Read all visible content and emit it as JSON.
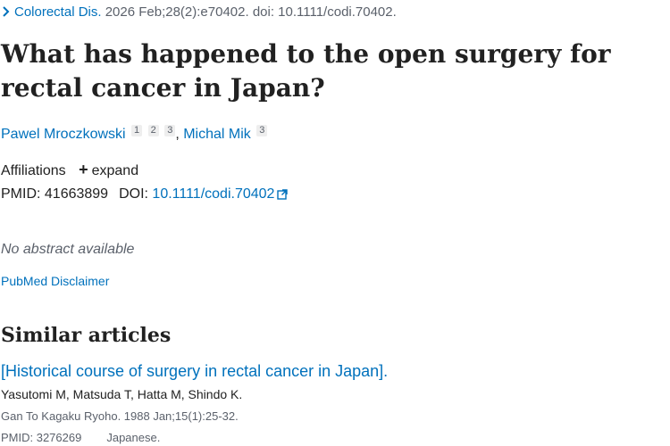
{
  "citation": {
    "journal": "Colorectal Dis.",
    "details": " 2026 Feb;28(2):e70402. doi: 10.1111/codi.70402."
  },
  "article": {
    "title": "What has happened to the open surgery for rectal cancer in Japan?",
    "authors": [
      {
        "name": "Pawel Mroczkowski",
        "affils": [
          "1",
          "2",
          "3"
        ]
      },
      {
        "name": "Michal Mik",
        "affils": [
          "3"
        ]
      }
    ],
    "author_separator": ", ",
    "affiliations_label": "Affiliations",
    "expand_label": "expand",
    "pmid_label": "PMID: ",
    "pmid": "41663899",
    "doi_label": "DOI: ",
    "doi": "10.1111/codi.70402",
    "no_abstract": "No abstract available",
    "disclaimer": "PubMed Disclaimer"
  },
  "similar": {
    "heading": "Similar articles",
    "items": [
      {
        "title": "[Historical course of surgery in rectal cancer in Japan].",
        "authors": "Yasutomi M, Matsuda T, Hatta M, Shindo K.",
        "journal": "Gan To Kagaku Ryoho. 1988 Jan;15(1):25-32.",
        "pmid": "PMID: 3276269",
        "language": "Japanese."
      }
    ]
  },
  "colors": {
    "link": "#0071bc",
    "text": "#212121",
    "muted": "#5b616b"
  },
  "icons": {
    "chevron": "chevron-right-icon",
    "expand": "plus-icon",
    "external": "external-link-icon"
  }
}
